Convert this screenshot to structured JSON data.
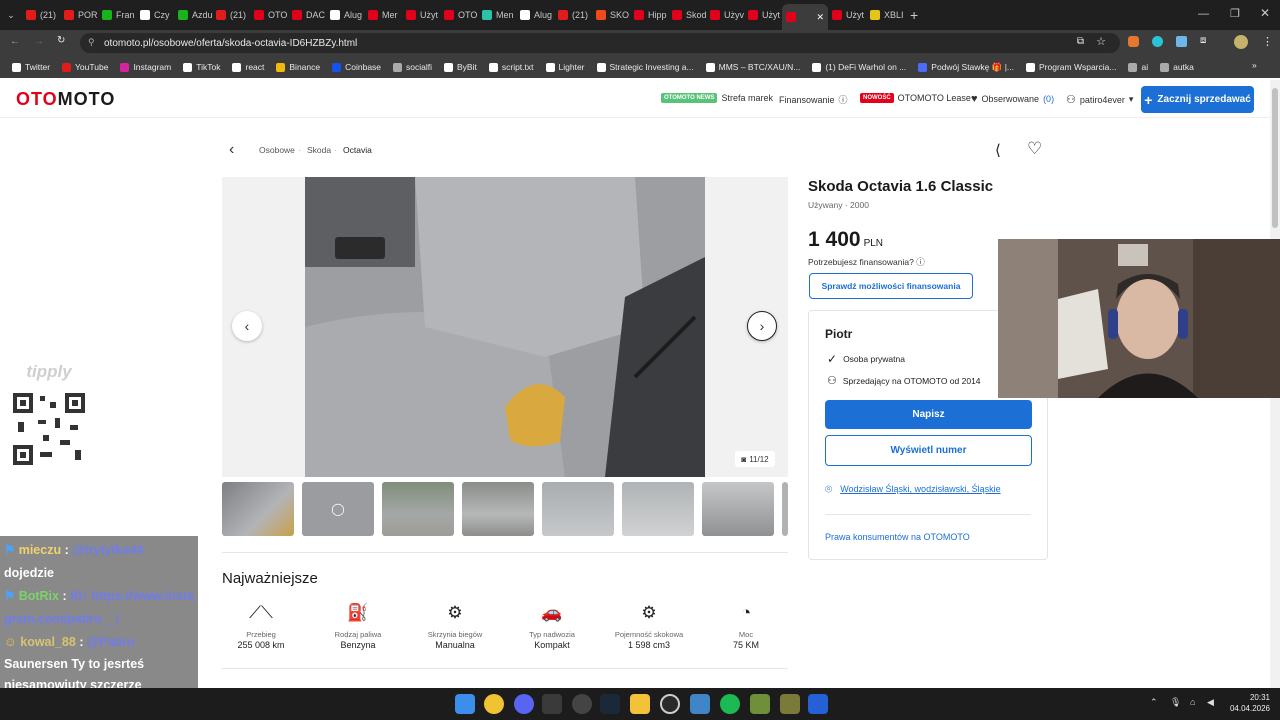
{
  "browser": {
    "tabs": [
      {
        "label": "(21)",
        "color": "#e21b1b"
      },
      {
        "label": "PORI",
        "color": "#e21b1b"
      },
      {
        "label": "Fran",
        "color": "#19b31c"
      },
      {
        "label": "Czy",
        "color": "#ffffff"
      },
      {
        "label": "Azdu",
        "color": "#19b31c"
      },
      {
        "label": "(21)",
        "color": "#e21b1b"
      },
      {
        "label": "OTO",
        "color": "#e2001a"
      },
      {
        "label": "DAC",
        "color": "#e2001a"
      },
      {
        "label": "Alug",
        "color": "#ffffff"
      },
      {
        "label": "Mer",
        "color": "#e2001a"
      },
      {
        "label": "Użyt",
        "color": "#e2001a"
      },
      {
        "label": "OTO",
        "color": "#e2001a"
      },
      {
        "label": "Men",
        "color": "#2bc3a6"
      },
      {
        "label": "Alug",
        "color": "#ffffff"
      },
      {
        "label": "(21)",
        "color": "#e21b1b"
      },
      {
        "label": "SKO",
        "color": "#f04a1d"
      },
      {
        "label": "Hipp",
        "color": "#e2001a"
      },
      {
        "label": "Skod",
        "color": "#e2001a"
      },
      {
        "label": "Użyv",
        "color": "#e2001a"
      },
      {
        "label": "Użyt",
        "color": "#e2001a"
      },
      {
        "label": "",
        "color": "#e2001a",
        "active": true
      },
      {
        "label": "Użyt",
        "color": "#e2001a"
      },
      {
        "label": "XBLI",
        "color": "#e6c419"
      }
    ],
    "url": "otomoto.pl/osobowe/oferta/skoda-octavia-ID6HZBZy.html",
    "bookmarks": [
      {
        "label": "Twitter",
        "color": "#ffffff"
      },
      {
        "label": "YouTube",
        "color": "#e21b1b"
      },
      {
        "label": "Instagram",
        "color": "#d6249f"
      },
      {
        "label": "TikTok",
        "color": "#ffffff"
      },
      {
        "label": "react",
        "color": "#ffffff"
      },
      {
        "label": "Binance",
        "color": "#f0b90b"
      },
      {
        "label": "Coinbase",
        "color": "#1652f0"
      },
      {
        "label": "socialfi",
        "color": "#aaaaaa"
      },
      {
        "label": "ByBit",
        "color": "#ffffff"
      },
      {
        "label": "script.txt",
        "color": "#ffffff"
      },
      {
        "label": "Lighter",
        "color": "#ffffff"
      },
      {
        "label": "Strategic Investing a...",
        "color": "#ffffff"
      },
      {
        "label": "MMS – BTC/XAU/N...",
        "color": "#ffffff"
      },
      {
        "label": "(1) DeFi Warhol on ...",
        "color": "#ffffff"
      },
      {
        "label": "Podwój Stawkę 🎁 |...",
        "color": "#4a6cf7"
      },
      {
        "label": "Program Wsparcia...",
        "color": "#ffffff"
      },
      {
        "label": "ai",
        "color": "#aaaaaa"
      },
      {
        "label": "autka",
        "color": "#aaaaaa"
      }
    ]
  },
  "site": {
    "logo_prefix": "OTO",
    "logo_suffix": "MOTO",
    "nav": {
      "news_badge": "OTOMOTO NEWS",
      "brands": "Strefa marek",
      "financing": "Finansowanie",
      "new_badge": "NOWOŚĆ",
      "lease": "OTOMOTO Lease",
      "watched": "Obserwowane",
      "watched_count": "(0)",
      "user": "patiro4ever",
      "sell": "Zacznij sprzedawać"
    },
    "breadcrumbs": [
      "Osobowe",
      "Skoda",
      "Octavia"
    ]
  },
  "listing": {
    "title": "Skoda Octavia 1.6 Classic",
    "subtitle": "Używany · 2000",
    "price": "1 400",
    "currency": "PLN",
    "finance_question": "Potrzebujesz finansowania?",
    "finance_button": "Sprawdź możliwości finansowania",
    "photo_counter": "11/12",
    "section_title": "Najważniejsze",
    "specs": [
      {
        "icon": "road-icon",
        "glyph": "⟋⟍",
        "label": "Przebieg",
        "value": "255 008 km"
      },
      {
        "icon": "fuel-icon",
        "glyph": "⛽",
        "label": "Rodzaj paliwa",
        "value": "Benzyna"
      },
      {
        "icon": "gearbox-icon",
        "glyph": "⚙",
        "label": "Skrzynia biegów",
        "value": "Manualna"
      },
      {
        "icon": "car-body-icon",
        "glyph": "🚗",
        "label": "Typ nadwozia",
        "value": "Kompakt"
      },
      {
        "icon": "engine-icon",
        "glyph": "⚙",
        "label": "Pojemność skokowa",
        "value": "1 598 cm3"
      },
      {
        "icon": "gauge-icon",
        "glyph": "◔",
        "label": "Moc",
        "value": "75 KM"
      }
    ]
  },
  "seller": {
    "name": "Piotr",
    "type": "Osoba prywatna",
    "since": "Sprzedający na OTOMOTO od 2014",
    "write_button": "Napisz",
    "phone_button": "Wyświetl numer",
    "location": "Wodzisław Śląski, wodzisławski, Śląskie",
    "consumer_rights": "Prawa konsumentów na OTOMOTO"
  },
  "overlay": {
    "tipply_label": "tipply",
    "chat": [
      {
        "user": "mieczu",
        "mention": "@trytytka44",
        "text": "dojedzie"
      },
      {
        "user": "BotRix",
        "mention": "",
        "text": "IG: https://www.instagram.com/patiro__/"
      },
      {
        "user": "kowal_88",
        "mention": "@Patiro",
        "text": "Saunersen Ty to jesrteś niesamowiuty szczerze"
      }
    ]
  },
  "taskbar": {
    "time": "20:31",
    "date": "04.04.2026"
  }
}
